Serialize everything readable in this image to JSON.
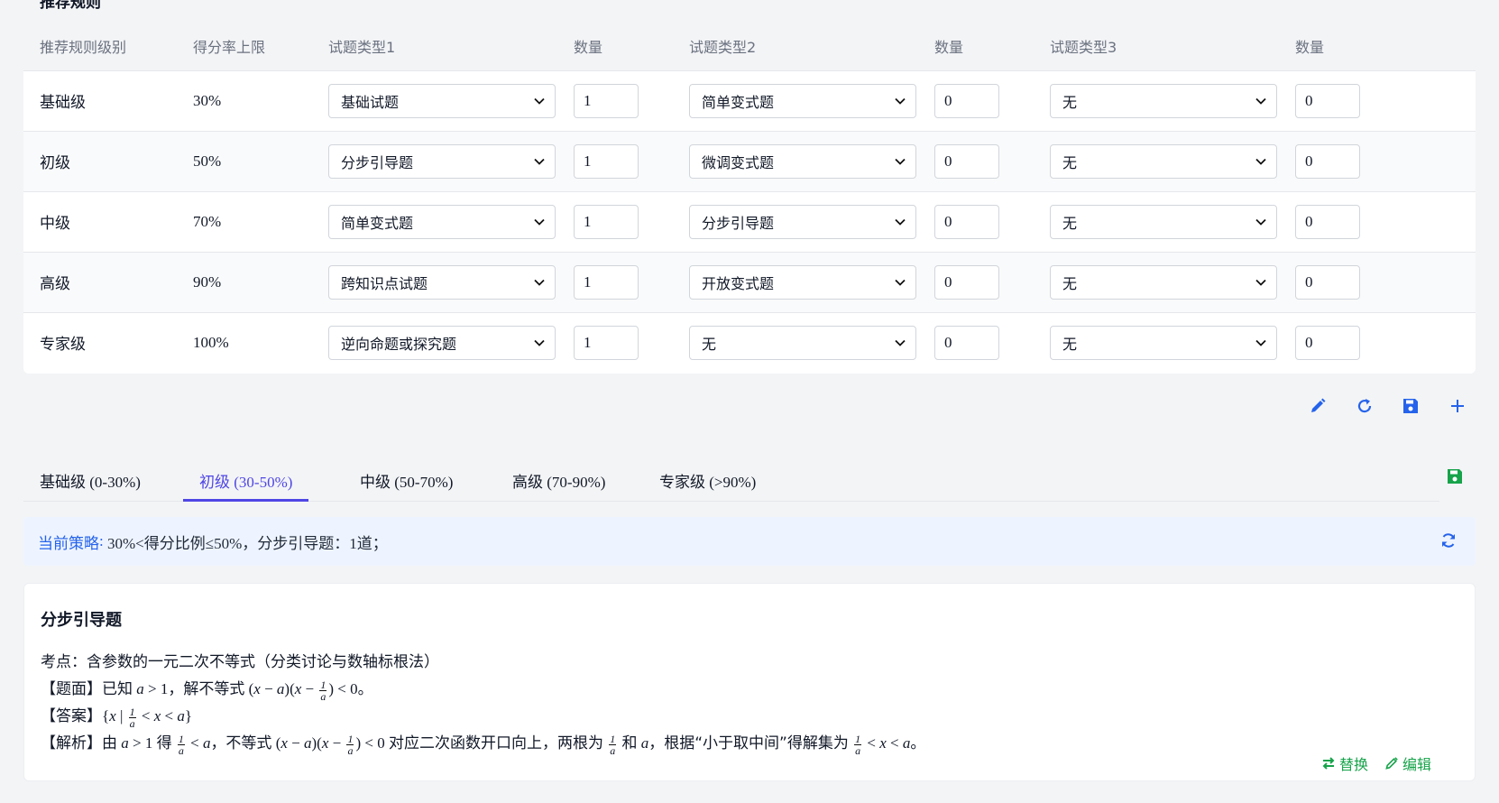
{
  "top_heading": "推荐规则",
  "table": {
    "headers": [
      "推荐规则级别",
      "得分率上限",
      "试题类型1",
      "数量",
      "试题类型2",
      "数量",
      "试题类型3",
      "数量"
    ],
    "rows": [
      {
        "level": "基础级",
        "limit": "30%",
        "type1": "基础试题",
        "qty1": "1",
        "type2": "简单变式题",
        "qty2": "0",
        "type3": "无",
        "qty3": "0"
      },
      {
        "level": "初级",
        "limit": "50%",
        "type1": "分步引导题",
        "qty1": "1",
        "type2": "微调变式题",
        "qty2": "0",
        "type3": "无",
        "qty3": "0"
      },
      {
        "level": "中级",
        "limit": "70%",
        "type1": "简单变式题",
        "qty1": "1",
        "type2": "分步引导题",
        "qty2": "0",
        "type3": "无",
        "qty3": "0"
      },
      {
        "level": "高级",
        "limit": "90%",
        "type1": "跨知识点试题",
        "qty1": "1",
        "type2": "开放变式题",
        "qty2": "0",
        "type3": "无",
        "qty3": "0"
      },
      {
        "level": "专家级",
        "limit": "100%",
        "type1": "逆向命题或探究题",
        "qty1": "1",
        "type2": "无",
        "qty2": "0",
        "type3": "无",
        "qty3": "0"
      }
    ]
  },
  "toolbar": {
    "icons": [
      "pencil-icon",
      "rotate-icon",
      "save-icon",
      "plus-icon"
    ],
    "accent": "#2563eb"
  },
  "tabs": [
    {
      "label": "基础级 (0-30%)"
    },
    {
      "label": "初级 (30-50%)",
      "active": true
    },
    {
      "label": "中级 (50-70%)"
    },
    {
      "label": "高级 (70-90%)"
    },
    {
      "label": "专家级 (>90%)"
    }
  ],
  "tab_accent": "#4f46e5",
  "strategy": {
    "label": "当前策略",
    "text": "30%<得分比例≤50%，分步引导题：1道；"
  },
  "question": {
    "title": "分步引导题",
    "point": "考点：含参数的一元二次不等式（分类讨论与数轴标根法）",
    "stem_prefix": "【题面】已知",
    "stem_mid": "，解不等式",
    "answer_prefix": "【答案】",
    "analysis_prefix": "【解析】由",
    "analysis_de": "得",
    "analysis_mid1": "，不等式",
    "analysis_mid2": "对应二次函数开口向上，两根为",
    "analysis_and": "和",
    "analysis_mid3": "，根据“小于取中间”得解集为",
    "replace_label": "替换",
    "edit_label": "编辑"
  },
  "colors": {
    "green": "#16a34a",
    "blue": "#2563eb"
  }
}
